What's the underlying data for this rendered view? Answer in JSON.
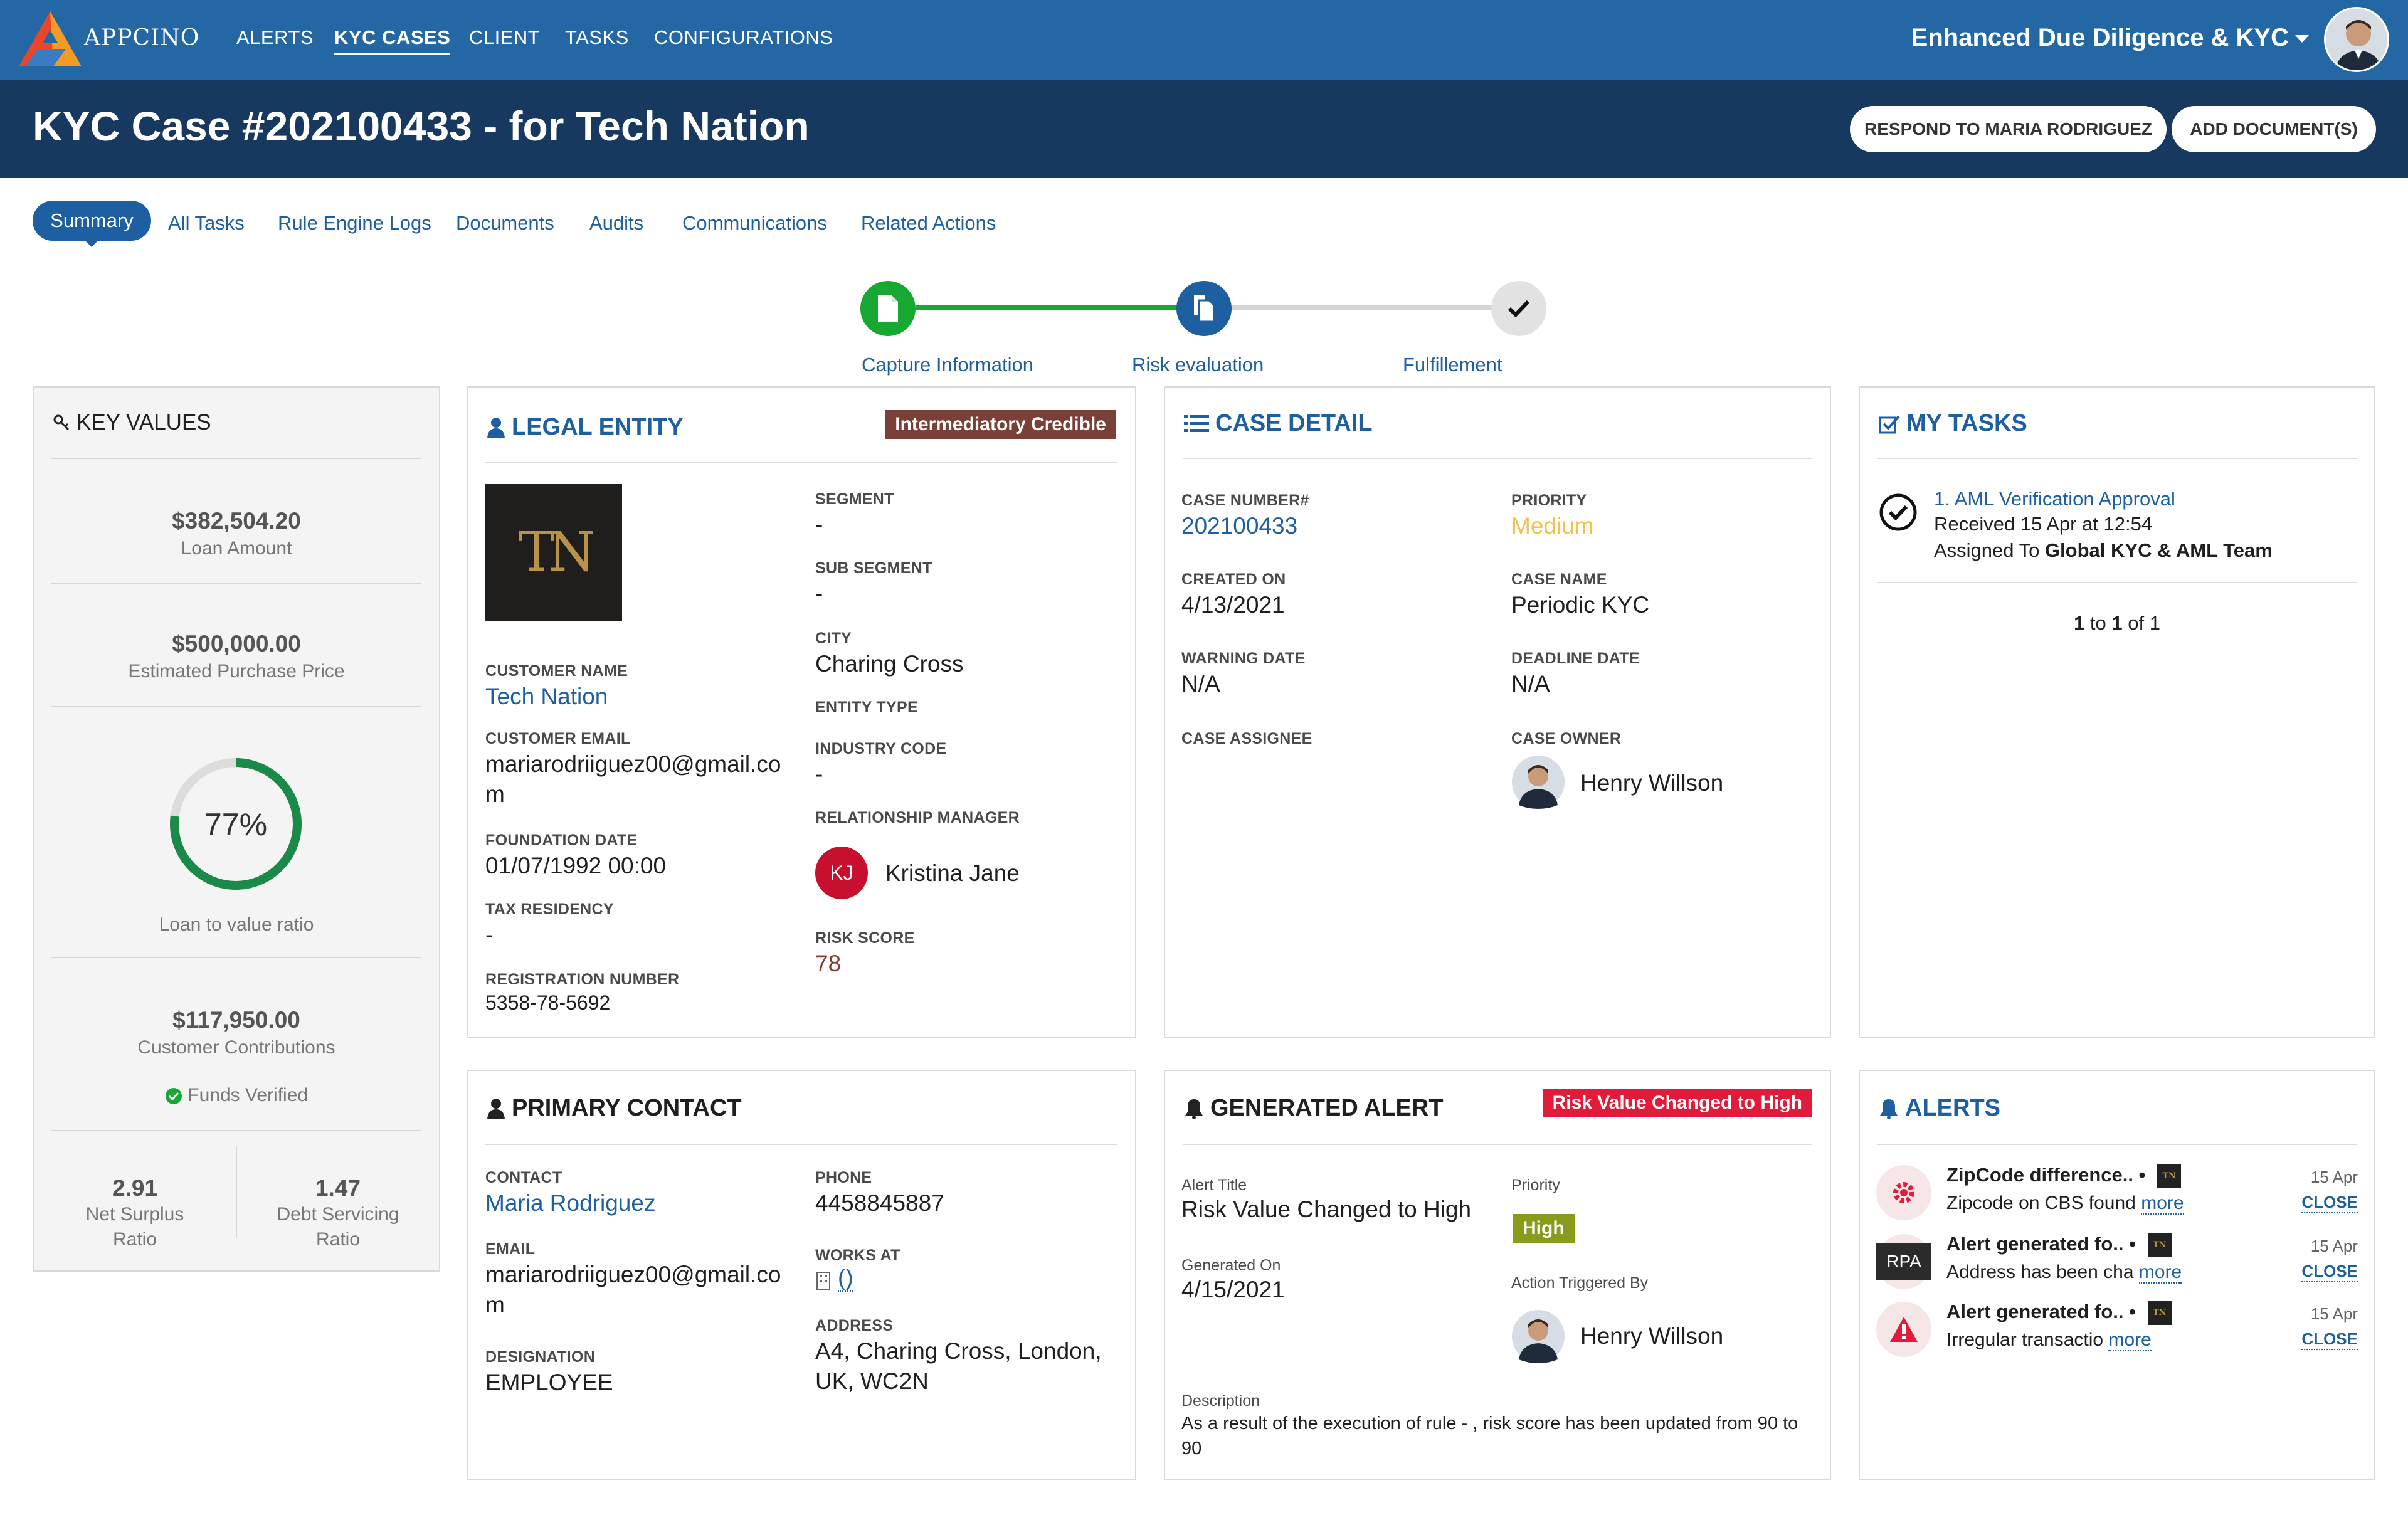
{
  "brand": {
    "name": "APPCINO"
  },
  "nav": {
    "items": [
      {
        "label": "ALERTS",
        "active": false
      },
      {
        "label": "KYC CASES",
        "active": true
      },
      {
        "label": "CLIENT",
        "active": false
      },
      {
        "label": "TASKS",
        "active": false
      },
      {
        "label": "CONFIGURATIONS",
        "active": false
      }
    ],
    "app_title": "Enhanced Due Diligence & KYC"
  },
  "case_header": {
    "title": "KYC Case #202100433 - for Tech Nation",
    "respond_button": "RESPOND TO MARIA RODRIGUEZ",
    "add_docs_button": "ADD DOCUMENT(S)"
  },
  "tabs": [
    "Summary",
    "All Tasks",
    "Rule Engine Logs",
    "Documents",
    "Audits",
    "Communications",
    "Related Actions"
  ],
  "progress": {
    "steps": [
      "Capture Information",
      "Risk evaluation",
      "Fulfillement"
    ]
  },
  "key_values": {
    "title": "KEY VALUES",
    "loan_amount": "$382,504.20",
    "loan_amount_label": "Loan Amount",
    "purchase_price": "$500,000.00",
    "purchase_price_label": "Estimated Purchase Price",
    "ltv_percent": 77,
    "ltv_text": "77%",
    "ltv_label": "Loan to value ratio",
    "contributions": "$117,950.00",
    "contributions_label": "Customer Contributions",
    "funds_verified": "Funds Verified",
    "net_surplus": "2.91",
    "net_surplus_label_1": "Net Surplus",
    "net_surplus_label_2": "Ratio",
    "debt_servicing": "1.47",
    "debt_servicing_label_1": "Debt Servicing",
    "debt_servicing_label_2": "Ratio"
  },
  "legal_entity": {
    "title": "LEGAL ENTITY",
    "badge": "Intermediatory Credible",
    "logo_text": "TN",
    "customer_name_label": "CUSTOMER NAME",
    "customer_name": "Tech Nation",
    "customer_email_label": "CUSTOMER EMAIL",
    "customer_email_1": "mariarodriiguez00@gmail.co",
    "customer_email_2": "m",
    "foundation_date_label": "FOUNDATION DATE",
    "foundation_date": "01/07/1992 00:00",
    "tax_residency_label": "TAX RESIDENCY",
    "tax_residency": "-",
    "registration_number_label": "REGISTRATION NUMBER",
    "registration_number": "5358-78-5692",
    "segment_label": "SEGMENT",
    "segment": "-",
    "sub_segment_label": "SUB SEGMENT",
    "sub_segment": "-",
    "city_label": "CITY",
    "city": "Charing Cross",
    "entity_type_label": "ENTITY TYPE",
    "industry_code_label": "INDUSTRY CODE",
    "industry_code": "-",
    "relationship_manager_label": "RELATIONSHIP MANAGER",
    "relationship_manager_initials": "KJ",
    "relationship_manager": "Kristina Jane",
    "risk_score_label": "RISK SCORE",
    "risk_score": "78"
  },
  "case_detail": {
    "title": "CASE DETAIL",
    "case_number_label": "CASE NUMBER#",
    "case_number": "202100433",
    "priority_label": "PRIORITY",
    "priority": "Medium",
    "created_on_label": "CREATED ON",
    "created_on": "4/13/2021",
    "case_name_label": "CASE NAME",
    "case_name": "Periodic KYC",
    "warning_date_label": "WARNING DATE",
    "warning_date": "N/A",
    "deadline_date_label": "DEADLINE DATE",
    "deadline_date": "N/A",
    "case_assignee_label": "CASE ASSIGNEE",
    "case_owner_label": "CASE OWNER",
    "case_owner": "Henry Willson"
  },
  "my_tasks": {
    "title": "MY TASKS",
    "task_title": "1. AML Verification Approval",
    "task_received": "Received 15 Apr at 12:54",
    "task_assigned_prefix": "Assigned To ",
    "task_assigned_team": "Global KYC & AML Team",
    "pager_from": "1",
    "pager_to_word": " to ",
    "pager_to": "1",
    "pager_of": " of 1"
  },
  "primary_contact": {
    "title": "PRIMARY CONTACT",
    "contact_label": "CONTACT",
    "contact": "Maria Rodriguez",
    "email_label": "EMAIL",
    "email_1": "mariarodriiguez00@gmail.co",
    "email_2": "m",
    "designation_label": "DESIGNATION",
    "designation": "EMPLOYEE",
    "phone_label": "PHONE",
    "phone": "4458845887",
    "works_at_label": "WORKS AT",
    "works_at": "()",
    "address_label": "ADDRESS",
    "address_1": "A4, Charing Cross, London,",
    "address_2": "UK, WC2N"
  },
  "generated_alert": {
    "title": "GENERATED ALERT",
    "badge": "Risk Value Changed to High",
    "alert_title_label": "Alert Title",
    "alert_title": "Risk Value Changed to High",
    "priority_label": "Priority",
    "priority": "High",
    "generated_on_label": "Generated On",
    "generated_on": "4/15/2021",
    "action_triggered_by_label": "Action Triggered By",
    "action_triggered_by": "Henry Willson",
    "description_label": "Description",
    "description_1": "As a result of the execution of rule - , risk score has been updated from 90 to",
    "description_2": "90"
  },
  "alerts": {
    "title": "ALERTS",
    "items": [
      {
        "title": "ZipCode difference..",
        "text": "Zipcode on CBS found",
        "more": "more",
        "date": "15 Apr",
        "close": "CLOSE",
        "icon": "gear-icon"
      },
      {
        "title": "Alert generated fo..",
        "text": "Address has been cha",
        "more": "more",
        "date": "15 Apr",
        "close": "CLOSE",
        "icon": "rpa-icon",
        "icon_label": "RPA"
      },
      {
        "title": "Alert generated fo..",
        "text": "Irregular transactio",
        "more": "more",
        "date": "15 Apr",
        "close": "CLOSE",
        "icon": "warning-icon"
      }
    ]
  },
  "colors": {
    "nav": "#2367a4",
    "case_bar": "#17395f",
    "accent": "#1d5fa0",
    "green": "#16a831",
    "badge_brown": "#7a3f36",
    "badge_red": "#e31b3a",
    "high_badge": "#8a9a1a",
    "priority_medium": "#f2c14e",
    "ltv_ring": "#1b8a48"
  }
}
